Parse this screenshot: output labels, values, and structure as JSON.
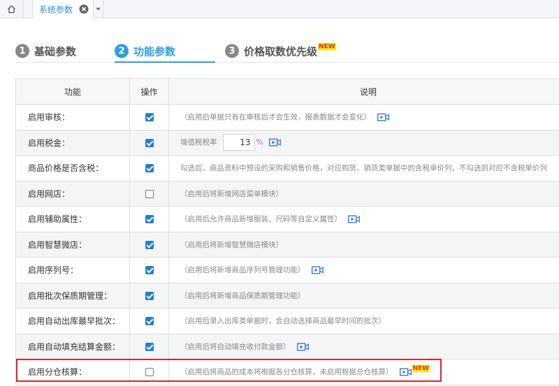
{
  "topbar": {
    "active_tab": "系统参数",
    "icons": {
      "home": "home-icon",
      "close": "close-circle-icon",
      "dropdown": "caret-down-icon"
    }
  },
  "steps": [
    {
      "num": "1",
      "label": "基础参数",
      "active": false
    },
    {
      "num": "2",
      "label": "功能参数",
      "active": true
    },
    {
      "num": "3",
      "label": "价格取数优先级",
      "active": false,
      "badge": "NEW"
    }
  ],
  "table": {
    "headers": {
      "func": "功能",
      "op": "操作",
      "desc": "说明"
    },
    "rows": [
      {
        "func": "启用审核：",
        "checked": true,
        "desc": "（启用后单据只有在审核后才会生效，报表数据才会变化）",
        "video": true
      },
      {
        "func": "启用税金：",
        "checked": true,
        "tax_label": "增值税税率",
        "tax_value": "13",
        "tax_unit": "%",
        "video": true
      },
      {
        "func": "商品价格是否含税：",
        "checked": true,
        "desc": "勾选后，商品资料中预设的采购和销售价格，对应购货、销货类单据中的含税单价列，不勾选则对应不含税单价列",
        "video": false
      },
      {
        "func": "启用网店：",
        "checked": false,
        "desc": "（启用后将新增网店菜单模块）",
        "video": false
      },
      {
        "func": "启用辅助属性：",
        "checked": true,
        "desc": "（启用后允许商品新增服装、尺码等自定义属性）",
        "video": true
      },
      {
        "func": "启用智慧微店：",
        "checked": true,
        "desc": "（启用后将新增智慧微店模块）",
        "video": false
      },
      {
        "func": "启用序列号：",
        "checked": true,
        "desc": "（启用后将新增商品序列号管理功能）",
        "video": true
      },
      {
        "func": "启用批次保质期管理：",
        "checked": true,
        "desc": "（启用后将新增商品保质期管理功能）",
        "video": false
      },
      {
        "func": "启用自动出库最早批次：",
        "checked": true,
        "desc": "（启用后录入出库类单据时，会自动选择商品最早时间的批次）",
        "video": false
      },
      {
        "func": "启用自动填充结算金额：",
        "checked": true,
        "desc": "（启用后将自动填充收付款金额）",
        "video": true
      },
      {
        "func": "启用分仓核算：",
        "checked": false,
        "desc": "（启用后将商品的成本将根据各分仓核算，未启用根据总仓核算）",
        "video": true,
        "badge": "NEW"
      }
    ]
  },
  "colors": {
    "accent": "#2b9fe0",
    "checkbox": "#1e7fd6",
    "highlight": "#d9262a",
    "badge_bg": "#ffe600"
  }
}
